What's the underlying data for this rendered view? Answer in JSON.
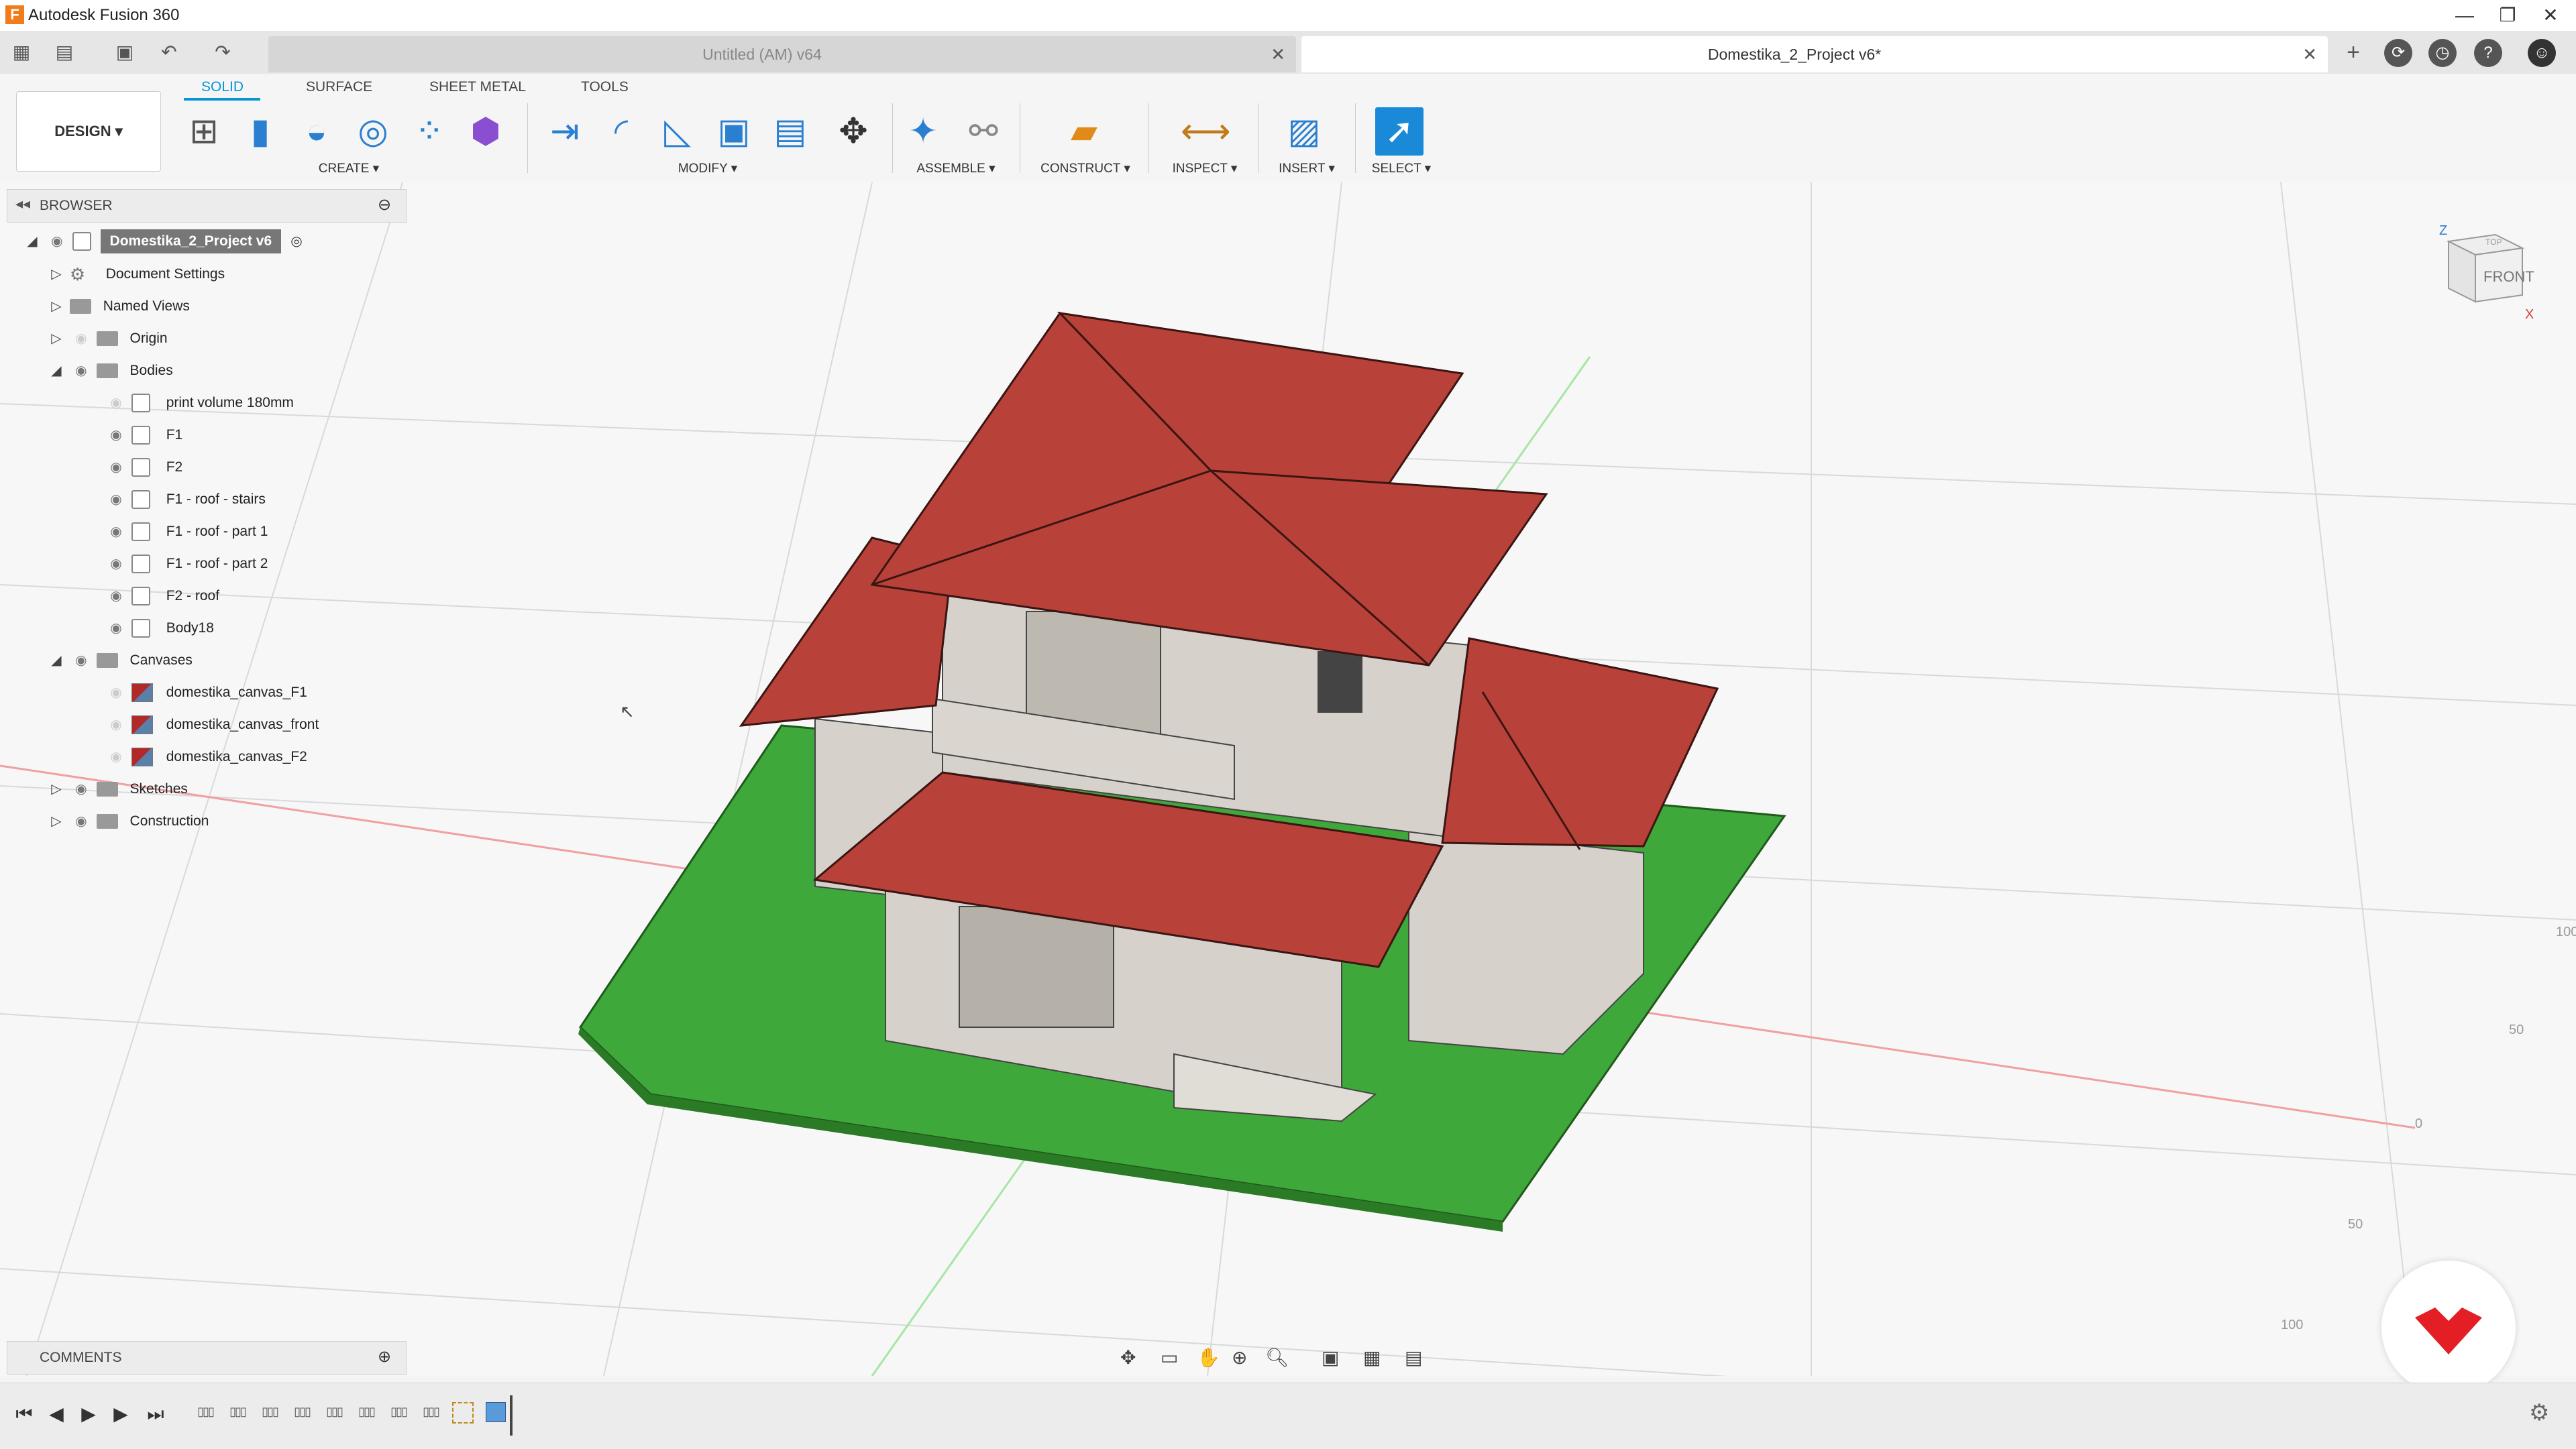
{
  "window": {
    "app_title": "Autodesk Fusion 360",
    "logo_letter": "F",
    "min": "—",
    "restore": "❐",
    "close": "✕"
  },
  "tabs": {
    "untitled": "Untitled (AM) v64",
    "domestika": "Domestika_2_Project v6*",
    "close_glyph": "✕",
    "new_tab_glyph": "+"
  },
  "toolbar": {
    "design": "DESIGN ▾",
    "workspace_tabs": [
      "SOLID",
      "SURFACE",
      "SHEET METAL",
      "TOOLS"
    ],
    "groups": [
      "CREATE ▾",
      "MODIFY ▾",
      "ASSEMBLE ▾",
      "CONSTRUCT ▾",
      "INSPECT ▾",
      "INSERT ▾",
      "SELECT ▾"
    ]
  },
  "browser": {
    "title": "BROWSER",
    "root": "Domestika_2_Project v6",
    "items": {
      "document_settings": "Document Settings",
      "named_views": "Named Views",
      "origin": "Origin",
      "bodies": "Bodies",
      "canvases": "Canvases",
      "sketches": "Sketches",
      "construction": "Construction"
    },
    "bodies": [
      "print volume 180mm",
      "F1",
      "F2",
      "F1 - roof - stairs",
      "F1 - roof - part 1",
      "F1 - roof - part 2",
      "F2 - roof",
      "Body18"
    ],
    "canvases": [
      "domestika_canvas_F1",
      "domestika_canvas_front",
      "domestika_canvas_F2"
    ]
  },
  "comments": {
    "title": "COMMENTS"
  },
  "viewcube": {
    "top": "TOP",
    "front": "FRONT",
    "z": "Z",
    "x": "X"
  },
  "grid_labels": [
    "100",
    "50",
    "0",
    "50",
    "100"
  ],
  "colors": {
    "accent": "#0696d7",
    "roof": "#b8423a",
    "ground": "#3fa83a",
    "walls": "#d6d2cb"
  },
  "icons": {
    "timeline_feature": "▯▯▯"
  }
}
